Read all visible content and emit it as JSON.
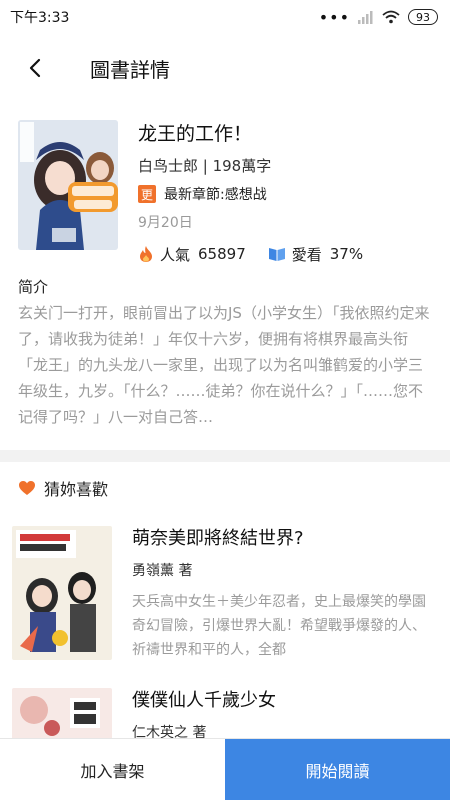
{
  "status": {
    "time": "下午3:33",
    "battery": "93"
  },
  "header": {
    "title": "圖書詳情"
  },
  "book": {
    "title": "龙王的工作！",
    "author_words": "白鸟士郎 | 198萬字",
    "chapter_badge": "更",
    "latest_chapter": "最新章節:感想战",
    "date": "9月20日",
    "popularity_label": "人氣",
    "popularity_value": "65897",
    "like_label": "愛看",
    "like_value": "37%"
  },
  "intro": {
    "heading": "简介",
    "text": "玄关门一打开，眼前冒出了以为JS（小学女生）「我依照约定来了，请收我为徒弟！」年仅十六岁，便拥有将棋界最高头衔「龙王」的九头龙八一家里，出现了以为名叫雏鹤爱的小学三年级生，九岁。「什么？……徒弟？你在说什么？」「……您不记得了吗？」八一对自己答…"
  },
  "recommend": {
    "heading": "猜妳喜歡",
    "items": [
      {
        "title": "萌奈美即將終結世界?",
        "author": "勇嶺薰 著",
        "desc": "天兵高中女生＋美少年忍者，史上最爆笑的學園奇幻冒險，引爆世界大亂！希望戰爭爆發的人、祈禱世界和平的人，全都"
      },
      {
        "title": "僕僕仙人千歲少女",
        "author": "仁木英之 著",
        "desc": ""
      }
    ]
  },
  "bottom": {
    "shelf_label": "加入書架",
    "read_label": "開始閱讀"
  }
}
